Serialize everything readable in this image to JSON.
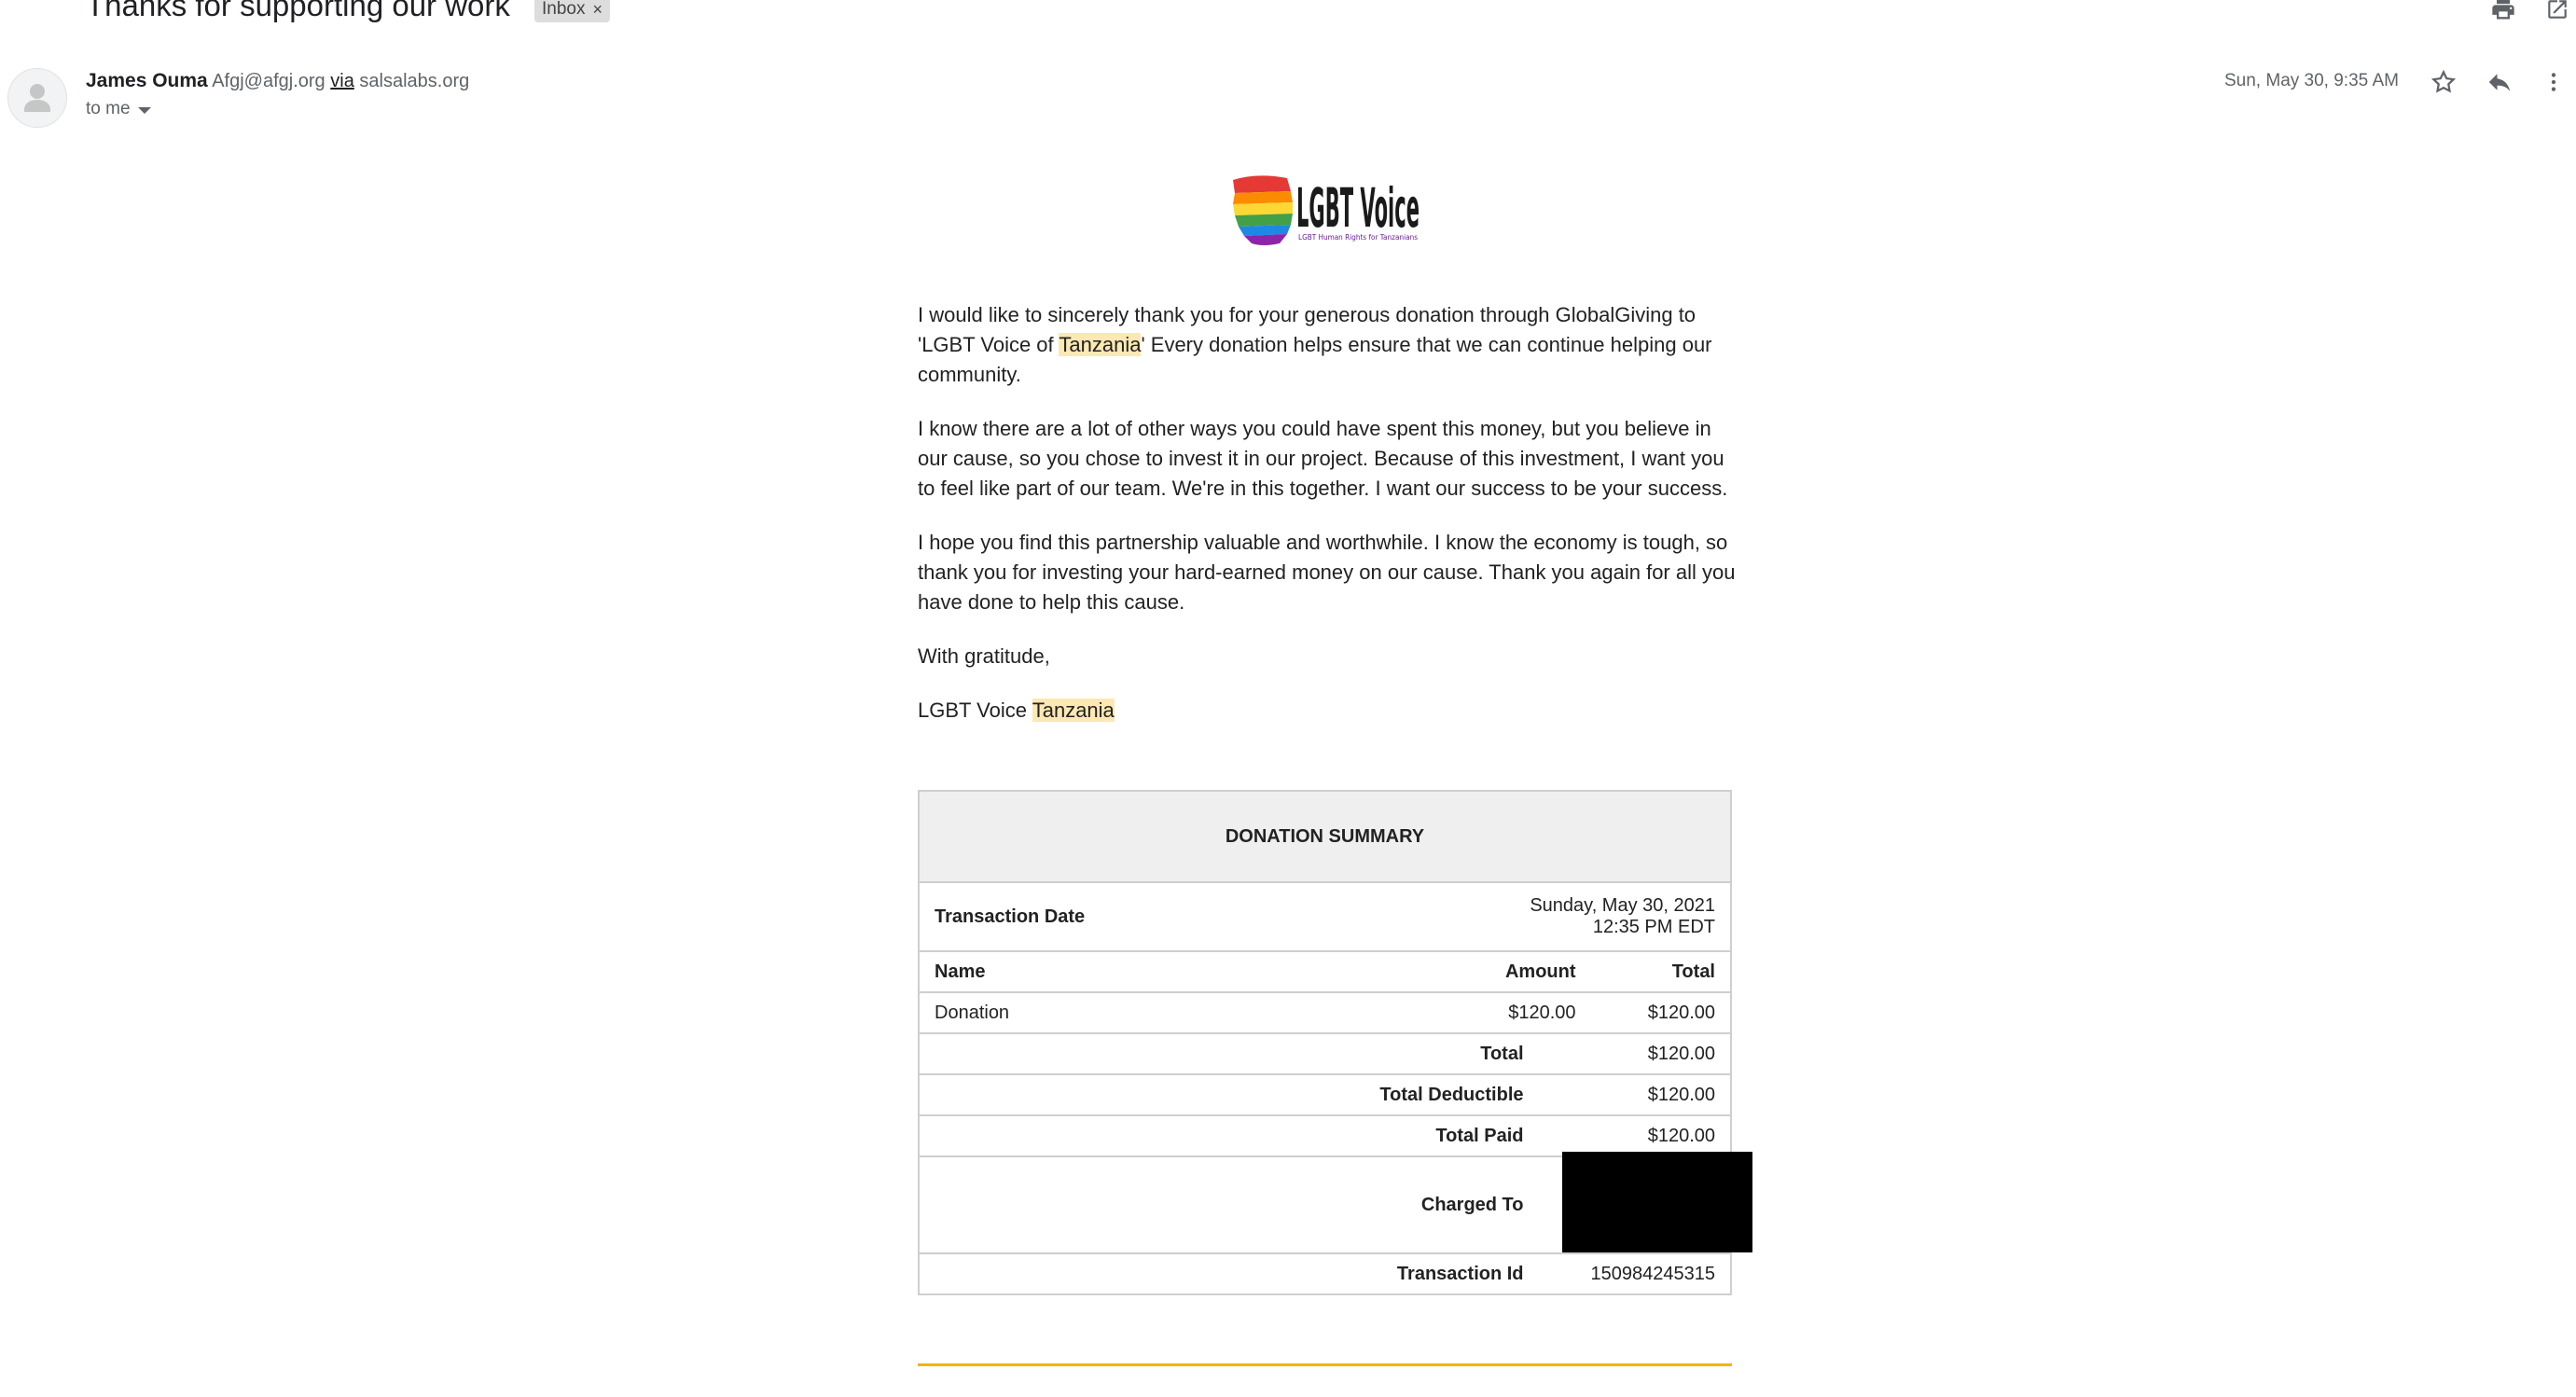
{
  "email": {
    "subject": "Thanks for supporting our work",
    "label_chip": "Inbox",
    "label_remove": "×",
    "sender_name": "James Ouma",
    "sender_email": "Afgj@afgj.org",
    "via_label": "via",
    "via_domain": "salsalabs.org",
    "recipient": "to me",
    "date": "Sun, May 30, 9:35 AM",
    "icons": [
      "print-icon",
      "open-in-new-icon",
      "star-icon",
      "reply-icon",
      "more-vert-icon"
    ]
  },
  "body": {
    "p1_a": "I would like to sincerely thank you for your generous donation through GlobalGiving to 'LGBT Voice of ",
    "p1_hl": "Tanzania",
    "p1_b": "' Every donation helps ensure that we can continue helping our community.",
    "p2": "I know there are a lot of other ways you could have spent this money, but you believe in our cause, so you chose to invest it in our project. Because of this investment, I want you to feel like part of our team. We're in this together. I want our success to be your success.",
    "p3": "I hope you find this partnership valuable and worthwhile. I know the economy is tough, so thank you for investing your hard-earned money on our cause. Thank you again for all you have done to help this cause.",
    "closing": "With gratitude,",
    "signature_a": "LGBT Voice ",
    "signature_hl": "Tanzania",
    "logo_text": "LGBT Voice",
    "logo_tagline": "LGBT Human Rights for Tanzanians"
  },
  "summary": {
    "title": "DONATION SUMMARY",
    "transaction_date_label": "Transaction Date",
    "transaction_date_1": "Sunday, May 30, 2021",
    "transaction_date_2": "12:35 PM EDT",
    "col_name": "Name",
    "col_amount": "Amount",
    "col_total": "Total",
    "items": [
      {
        "name": "Donation",
        "amount": "$120.00",
        "total": "$120.00"
      }
    ],
    "total_label": "Total",
    "total_value": "$120.00",
    "deductible_label": "Total Deductible",
    "deductible_value": "$120.00",
    "paid_label": "Total Paid",
    "paid_value": "$120.00",
    "charged_label": "Charged To",
    "txn_label": "Transaction Id",
    "txn_value": "150984245315"
  },
  "colors": {
    "highlight": "#fce8b2",
    "rule": "#f4b400",
    "table_header_bg": "#efefef"
  }
}
